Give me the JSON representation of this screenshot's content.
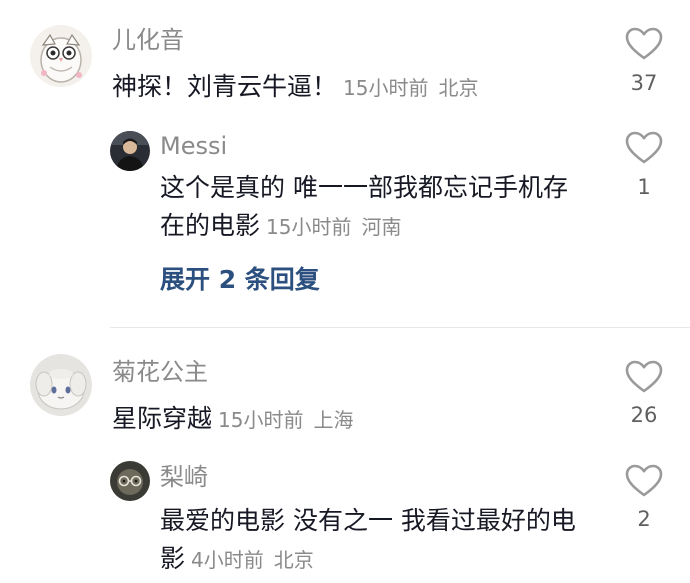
{
  "comments": [
    {
      "username": "儿化音",
      "text": "神探！刘青云牛逼！",
      "time": "15小时前",
      "location": "北京",
      "likes": "37",
      "reply": {
        "username": "Messi",
        "text": "这个是真的  唯一一部我都忘记手机存在的电影",
        "time": "15小时前",
        "location": "河南",
        "likes": "1"
      },
      "expand_label": "展开 2 条回复"
    },
    {
      "username": "菊花公主",
      "text": "星际穿越",
      "time": "15小时前",
      "location": "上海",
      "likes": "26",
      "reply": {
        "username": "梨崎",
        "text": "最爱的电影 没有之一 我看过最好的电影",
        "time": "4小时前",
        "location": "北京",
        "likes": "2"
      }
    }
  ],
  "icons": {
    "like": "heart-outline-icon"
  },
  "colors": {
    "username": "#8a8a8a",
    "content": "#161823",
    "meta": "#8a8a8a",
    "expand_link": "#2b4f7e",
    "like_icon": "#9a9a9a",
    "divider": "#e8e8e8"
  }
}
